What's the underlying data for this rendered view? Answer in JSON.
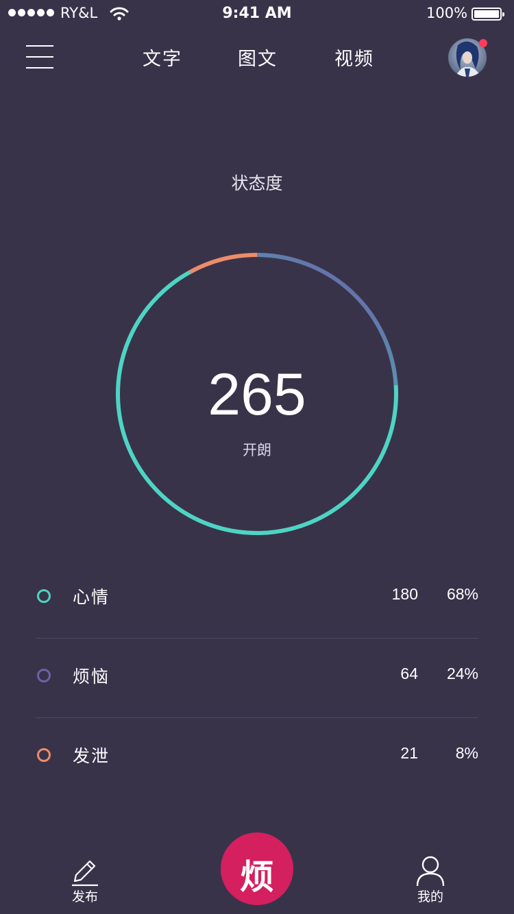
{
  "status_bar": {
    "carrier": "RY&L",
    "time": "9:41 AM",
    "battery": "100%",
    "battery_level": 1.0
  },
  "nav": {
    "tabs": [
      {
        "label": "文字"
      },
      {
        "label": "图文"
      },
      {
        "label": "视频"
      }
    ],
    "menu_icon": "menu-icon",
    "has_notification": true
  },
  "summary": {
    "title": "状态度",
    "score": "265",
    "mood": "开朗"
  },
  "stats": [
    {
      "name": "心情",
      "count": "180",
      "percent": "68%",
      "color": "#4ed4c4"
    },
    {
      "name": "烦恼",
      "count": "64",
      "percent": "24%",
      "color": "#6a63a8"
    },
    {
      "name": "发泄",
      "count": "21",
      "percent": "8%",
      "color": "#ee8c6a"
    }
  ],
  "chart_data": {
    "type": "pie",
    "categories": [
      "心情",
      "烦恼",
      "发泄"
    ],
    "values": [
      68,
      24,
      8
    ],
    "colors": [
      "#4ed4c4",
      "#6a63a8",
      "#ee8c6a"
    ]
  },
  "bottom_bar": {
    "publish_label": "发布",
    "center_label": "烦",
    "profile_label": "我的"
  },
  "colors": {
    "background": "#39334a",
    "accent": "#d4205e",
    "divider": "#4d4760"
  }
}
